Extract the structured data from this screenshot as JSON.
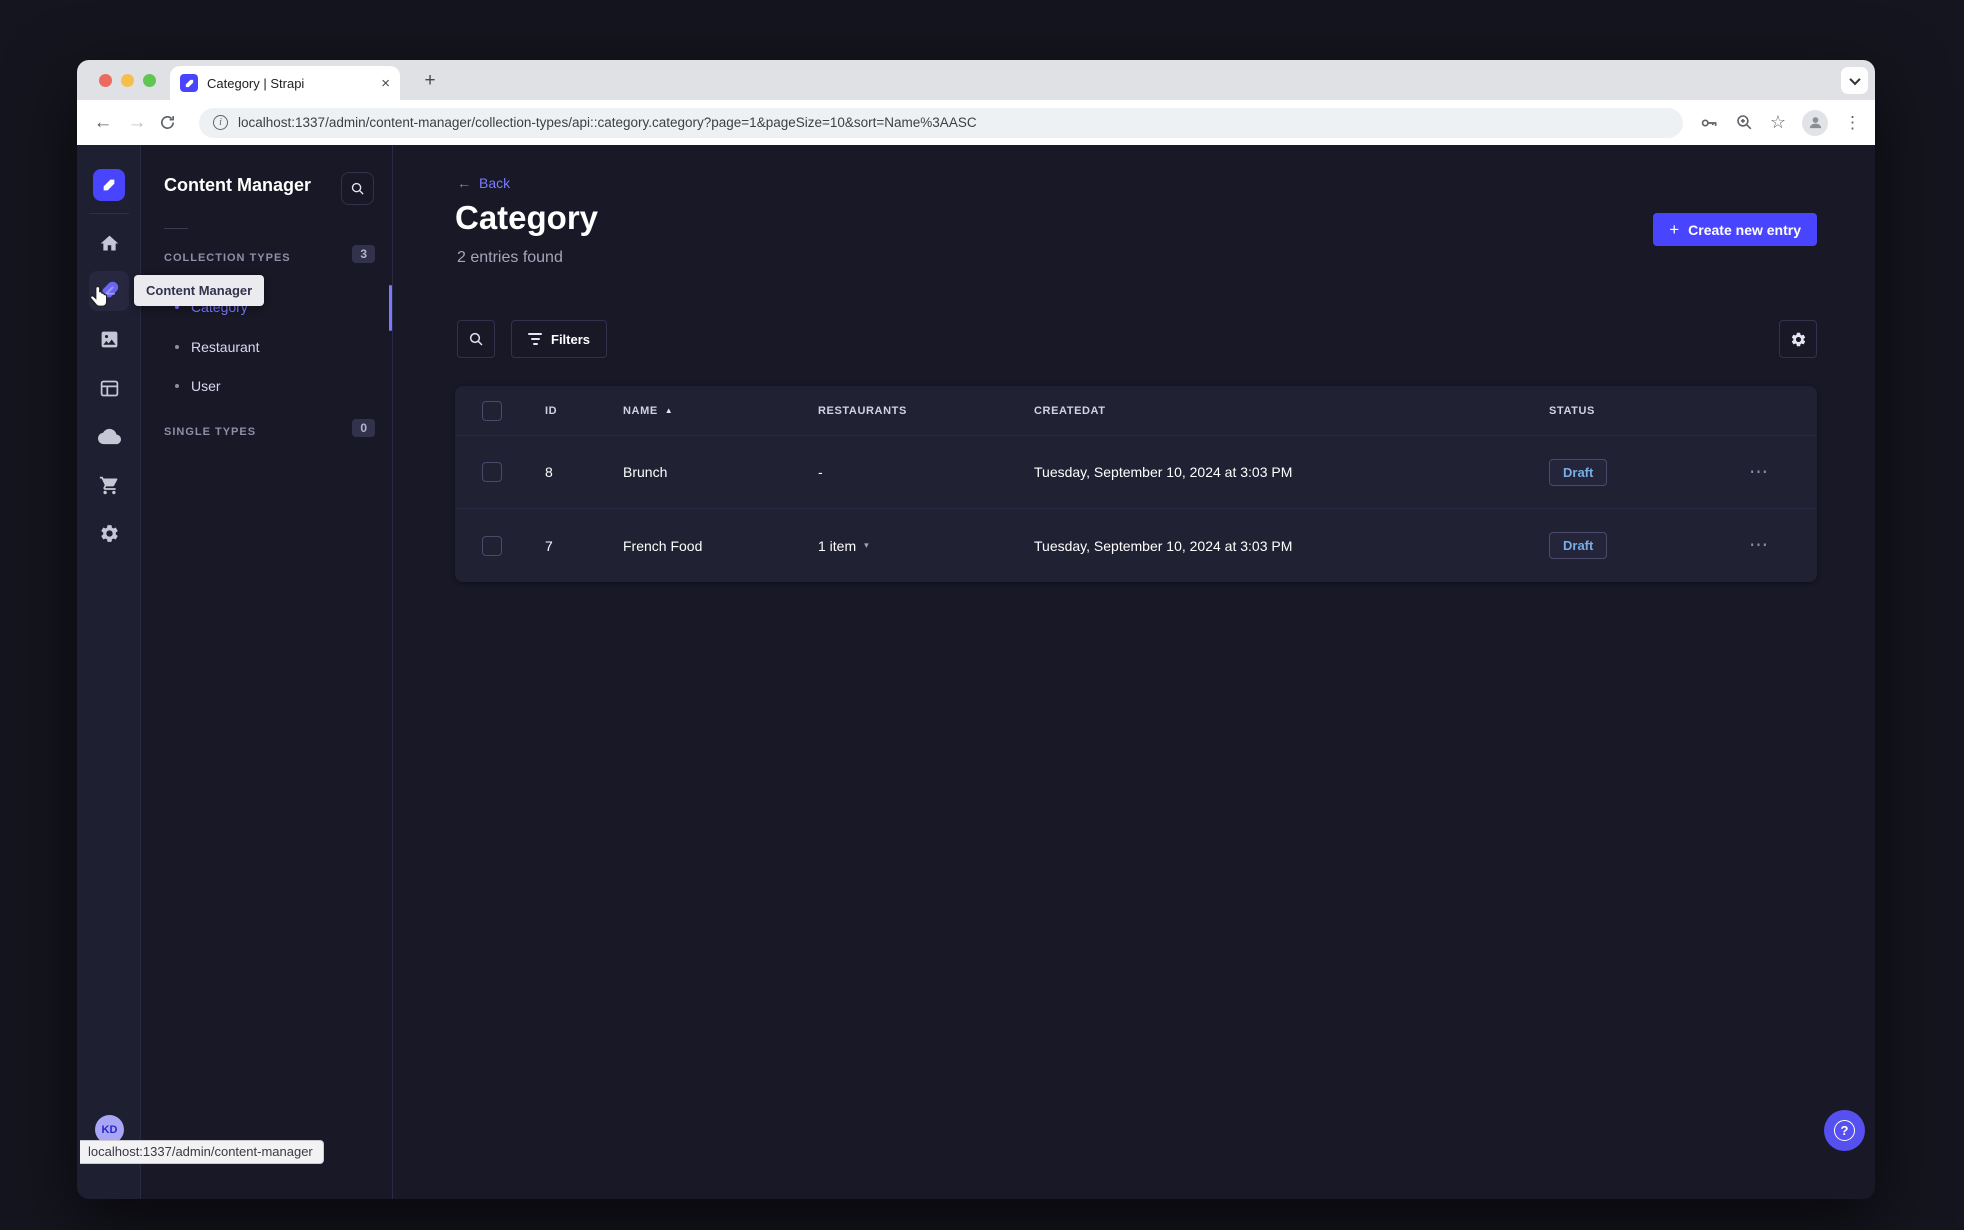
{
  "browser": {
    "tab_title": "Category | Strapi",
    "url": "localhost:1337/admin/content-manager/collection-types/api::category.category?page=1&pageSize=10&sort=Name%3AASC"
  },
  "nav": {
    "user_initials": "KD"
  },
  "subnav": {
    "title": "Content Manager",
    "collection_types_label": "COLLECTION TYPES",
    "collection_types_count": "3",
    "single_types_label": "SINGLE TYPES",
    "single_types_count": "0",
    "items": [
      {
        "label": "Category"
      },
      {
        "label": "Restaurant"
      },
      {
        "label": "User"
      }
    ]
  },
  "tooltip": {
    "label": "Content Manager"
  },
  "status_bar": {
    "url": "localhost:1337/admin/content-manager"
  },
  "main": {
    "back_label": "Back",
    "title": "Category",
    "subtitle": "2 entries found",
    "create_button_label": "Create new entry",
    "filters_button_label": "Filters"
  },
  "table": {
    "headers": {
      "id": "ID",
      "name": "NAME",
      "restaurants": "RESTAURANTS",
      "createdat": "CREATEDAT",
      "status": "STATUS"
    },
    "rows": [
      {
        "id": "8",
        "name": "Brunch",
        "restaurants": "-",
        "createdat": "Tuesday, September 10, 2024 at 3:03 PM",
        "status": "Draft"
      },
      {
        "id": "7",
        "name": "French Food",
        "restaurants": "1 item",
        "createdat": "Tuesday, September 10, 2024 at 3:03 PM",
        "status": "Draft"
      }
    ]
  },
  "icons": {
    "close": "×",
    "new_tab": "+",
    "back_arrow": "←",
    "forward_arrow": "→",
    "star": "☆",
    "kebab": "⋮",
    "more": "⋯",
    "sort_asc": "▲",
    "chevron_down": "▾",
    "plus": "+",
    "info": "i",
    "help": "?"
  },
  "colors": {
    "primary": "#4945ff",
    "primary_light": "#7b79ff",
    "draft_text": "#78aee4",
    "background": "#181826",
    "surface": "#212134"
  }
}
